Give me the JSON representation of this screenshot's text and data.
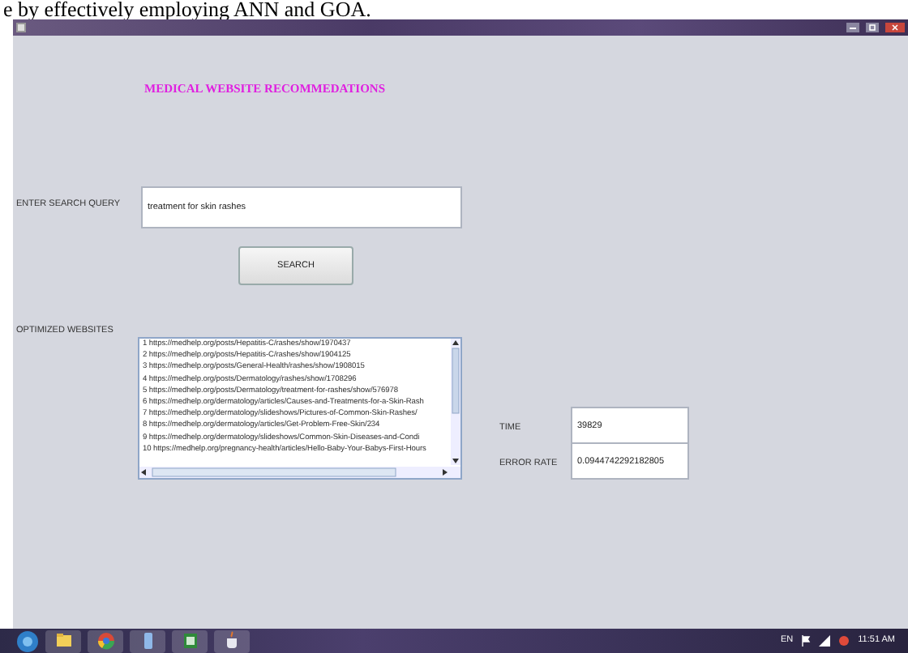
{
  "caption": "e by effectively employing ANN and GOA.",
  "window": {
    "heading": "MEDICAL WEBSITE RECOMMEDATIONS",
    "search": {
      "label": "ENTER SEARCH QUERY",
      "value": "treatment for skin rashes"
    },
    "search_button": "SEARCH",
    "results": {
      "label": "OPTIMIZED WEBSITES",
      "items": [
        "1 https://medhelp.org/posts/Hepatitis-C/rashes/show/1970437",
        "2 https://medhelp.org/posts/Hepatitis-C/rashes/show/1904125",
        "3 https://medhelp.org/posts/General-Health/rashes/show/1908015",
        "4 https://medhelp.org/posts/Dermatology/rashes/show/1708296",
        "5 https://medhelp.org/posts/Dermatology/treatment-for-rashes/show/576978",
        "6 https://medhelp.org/dermatology/articles/Causes-and-Treatments-for-a-Skin-Rash",
        "7 https://medhelp.org/dermatology/slideshows/Pictures-of-Common-Skin-Rashes/",
        "8 https://medhelp.org/dermatology/articles/Get-Problem-Free-Skin/234",
        "9 https://medhelp.org/dermatology/slideshows/Common-Skin-Diseases-and-Condi",
        "10 https://medhelp.org/pregnancy-health/articles/Hello-Baby-Your-Babys-First-Hours"
      ]
    },
    "time": {
      "label": "TIME",
      "value": "39829"
    },
    "error_rate": {
      "label": "ERROR RATE",
      "value": "0.0944742292182805"
    }
  },
  "taskbar": {
    "apps": [
      {
        "kind": "folder"
      },
      {
        "kind": "browser"
      },
      {
        "kind": "tower"
      },
      {
        "kind": "sheet"
      },
      {
        "kind": "cup"
      }
    ],
    "tray": {
      "language": "EN",
      "clock": "11:51 AM"
    }
  }
}
